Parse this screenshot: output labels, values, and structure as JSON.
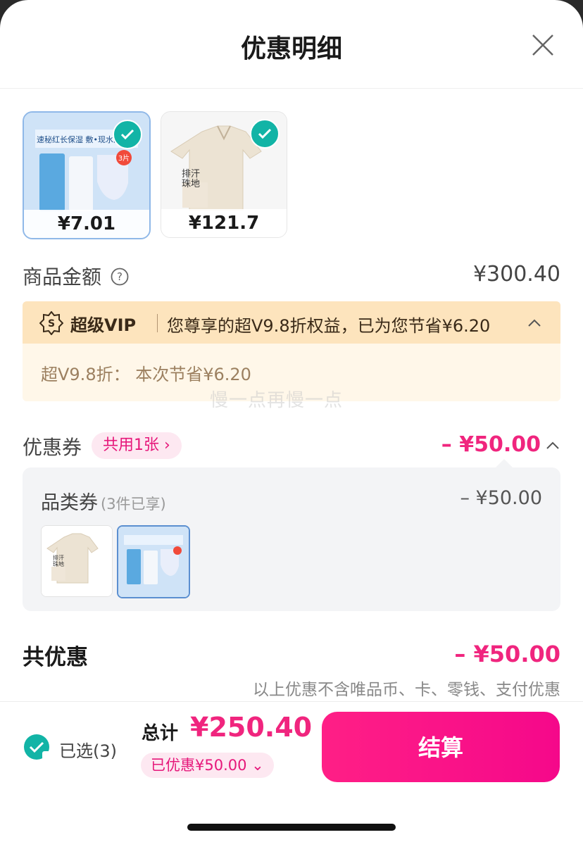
{
  "header": {
    "title": "优惠明细"
  },
  "products": [
    {
      "price": "¥7.01",
      "banner": "速秘红长保湿 敷•现水润透亮",
      "tag": "3片"
    },
    {
      "price": "¥121.7",
      "tag": "排汗\n珠地"
    }
  ],
  "amount": {
    "label": "商品金额",
    "value": "¥300.40"
  },
  "vip": {
    "title": "超级VIP",
    "desc": "您尊享的超V9.8折权益，已为您节省¥6.20",
    "detail": "超V9.8折：  本次节省¥6.20"
  },
  "watermark": "慢一点再慢一点",
  "coupon": {
    "label": "优惠券",
    "pill": "共用1张",
    "amount": "– ¥50.00",
    "category_label": "品类券",
    "category_note": "(3件已享)",
    "category_amount": "– ¥50.00"
  },
  "total": {
    "label": "共优惠",
    "amount": "– ¥50.00",
    "note": "以上优惠不含唯品币、卡、零钱、支付优惠"
  },
  "footer": {
    "selected": "已选(3)",
    "sum_label": "总计",
    "sum_value": "¥250.40",
    "saved": "已优惠¥50.00",
    "checkout": "结算"
  },
  "colors": {
    "accent": "#f0257e",
    "check": "#12b4a6",
    "vip_bg": "#fde4bd"
  }
}
